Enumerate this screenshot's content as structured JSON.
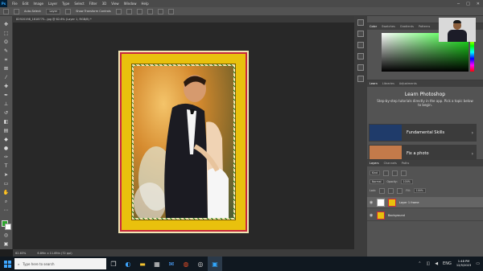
{
  "app": {
    "logo_text": "Ps"
  },
  "menu": [
    "File",
    "Edit",
    "Image",
    "Layer",
    "Type",
    "Select",
    "Filter",
    "3D",
    "View",
    "Window",
    "Help"
  ],
  "window_controls": [
    "─",
    "□",
    "✕"
  ],
  "options_bar": {
    "auto_select_label": "Auto-Select:",
    "layer_dropdown": "Layer",
    "show_transform_label": "Show Transform Controls"
  },
  "document_tab": {
    "title": "82920198_1618775...jpg @ 62.6% (Layer 1, RGB/8) *"
  },
  "status": {
    "zoom": "62.63%",
    "doc_size": "6.89in x 11.69in (72 ppi)"
  },
  "panels": {
    "color_tabs": [
      "Color",
      "Swatches",
      "Gradients",
      "Patterns"
    ],
    "learn_tabs": [
      "Learn",
      "Libraries",
      "Adjustments"
    ],
    "learn_title": "Learn Photoshop",
    "learn_desc": "Step-by-step tutorials directly in the app. Pick a topic below to begin.",
    "tutorials": [
      {
        "label": "Fundamental Skills",
        "thumb_color": "#1f3b6a"
      },
      {
        "label": "Fix a photo",
        "thumb_color": "#c37a4a"
      }
    ],
    "layers_tabs": [
      "Layers",
      "Channels",
      "Paths"
    ],
    "layer_kind": "Kind",
    "blend_mode": "Normal",
    "opacity_label": "Opacity:",
    "opacity_value": "100%",
    "lock_label": "Lock:",
    "fill_label": "Fill:",
    "fill_value": "100%",
    "layers": [
      {
        "name": "Layer 1 frame"
      },
      {
        "name": "Background"
      }
    ]
  },
  "taskbar": {
    "search_placeholder": "Type here to search",
    "time": "1:48 PM",
    "date": "12/5/2023",
    "language": "ENG"
  },
  "colors": {
    "foreground": "#2ea52e",
    "background": "#ffffff",
    "frame_gold": "#e9c10d",
    "frame_red": "#c8283c"
  }
}
